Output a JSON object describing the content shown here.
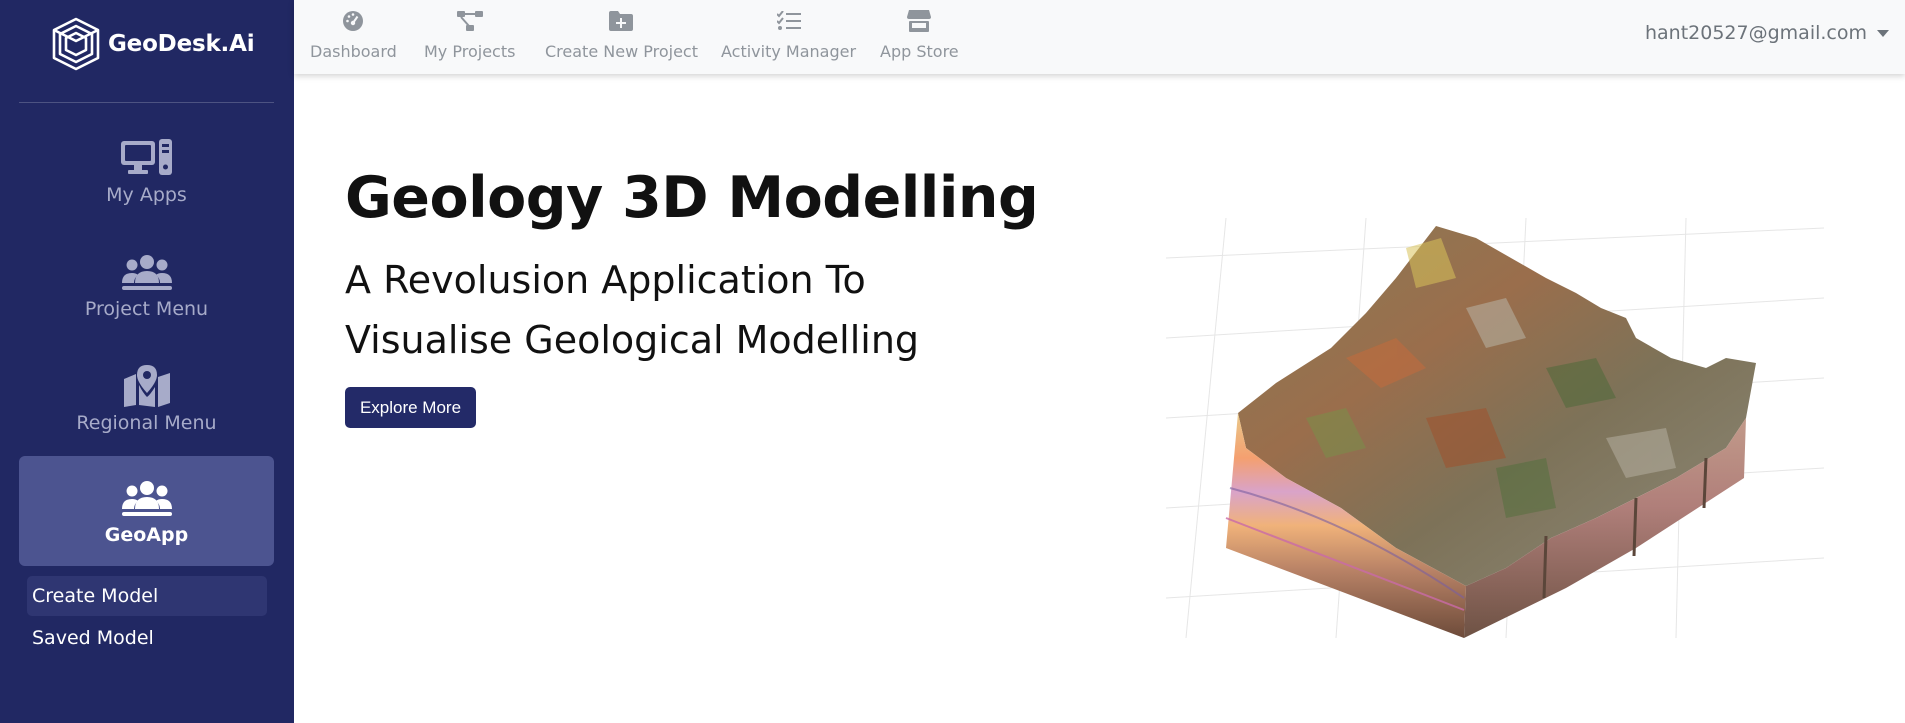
{
  "app": {
    "brand": "GeoDesk.Ai"
  },
  "sidebar": {
    "items": [
      {
        "label": "My Apps",
        "icon": "desktop-icon"
      },
      {
        "label": "Project Menu",
        "icon": "users-icon"
      },
      {
        "label": "Regional Menu",
        "icon": "map-marker-icon"
      },
      {
        "label": "GeoApp",
        "icon": "users-icon",
        "active": true
      }
    ],
    "subitems": [
      {
        "label": "Create Model",
        "active": true
      },
      {
        "label": "Saved Model"
      }
    ]
  },
  "topnav": {
    "items": [
      {
        "label": "Dashboard",
        "icon": "gauge-icon"
      },
      {
        "label": "My Projects",
        "icon": "project-diagram-icon"
      },
      {
        "label": "Create New Project",
        "icon": "folder-plus-icon"
      },
      {
        "label": "Activity Manager",
        "icon": "tasks-icon"
      },
      {
        "label": "App Store",
        "icon": "store-icon"
      }
    ],
    "user_email": "hant20527@gmail.com"
  },
  "hero": {
    "title": "Geology 3D Modelling",
    "subtitle_line1": "A Revolusion Application To",
    "subtitle_line2": "Visualise Geological Modelling",
    "cta": "Explore More"
  },
  "colors": {
    "sidebar_bg": "#212863",
    "sidebar_active": "#4c5490",
    "button_bg": "#232a68",
    "topbar_bg": "#f8f9fa"
  }
}
